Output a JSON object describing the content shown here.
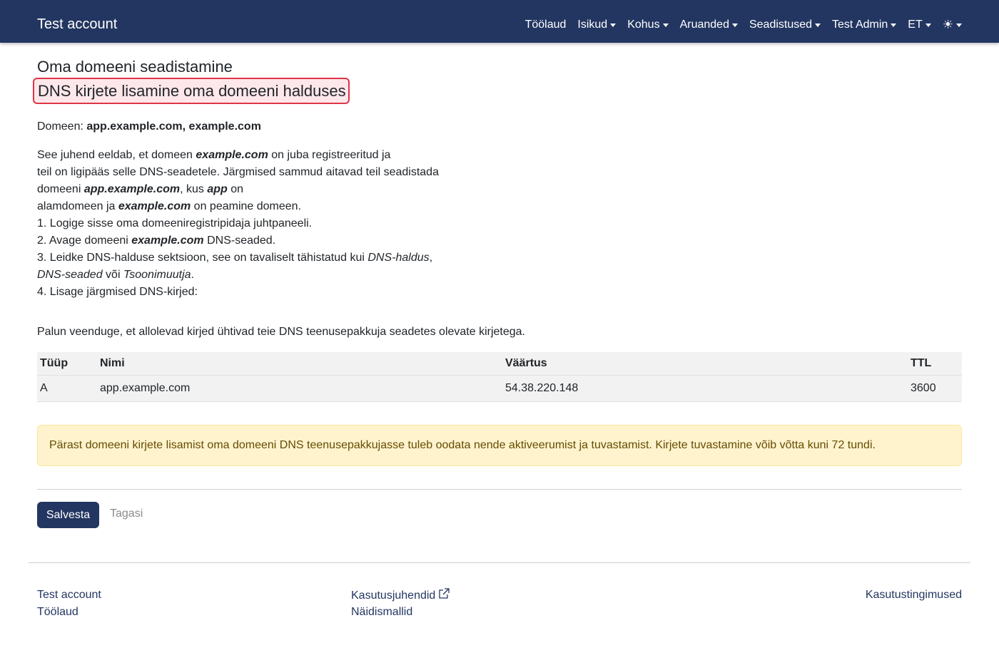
{
  "navbar": {
    "brand": "Test account",
    "items": [
      {
        "label": "Töölaud",
        "dropdown": false
      },
      {
        "label": "Isikud",
        "dropdown": true
      },
      {
        "label": "Kohus",
        "dropdown": true
      },
      {
        "label": "Aruanded",
        "dropdown": true
      },
      {
        "label": "Seadistused",
        "dropdown": true
      },
      {
        "label": "Test Admin",
        "dropdown": true
      },
      {
        "label": "ET",
        "dropdown": true
      }
    ],
    "theme_icon": "sun-icon"
  },
  "page": {
    "title": "Oma domeeni seadistamine",
    "subtitle": "DNS kirjete lisamine oma domeeni halduses",
    "domain_label": "Domeen:",
    "domain_value": "app.example.com, example.com"
  },
  "guide": {
    "p1_a": "See juhend eeldab, et domeen ",
    "p1_b": "example.com",
    "p1_c": " on juba registreeritud ja",
    "p2": "teil on ligipääs selle DNS-seadetele. Järgmised sammud aitavad teil seadistada",
    "p3_a": "domeeni ",
    "p3_b": "app.example.com",
    "p3_c": ", kus ",
    "p3_d": "app",
    "p3_e": " on",
    "p4_a": "alamdomeen ja ",
    "p4_b": "example.com",
    "p4_c": " on peamine domeen.",
    "step1": "1. Logige sisse oma domeeniregistripidaja juhtpaneeli.",
    "step2_a": "2. Avage domeeni ",
    "step2_b": "example.com",
    "step2_c": " DNS-seaded.",
    "step3_a": "3. Leidke DNS-halduse sektsioon, see on tavaliselt tähistatud kui ",
    "step3_b": "DNS-haldus",
    "step3_c": ",",
    "step3_d": "DNS-seaded",
    "step3_e": " või ",
    "step3_f": "Tsoonimuutja",
    "step3_g": ".",
    "step4": "4. Lisage järgmised DNS-kirjed:"
  },
  "confirm_text": "Palun veenduge, et allolevad kirjed ühtivad teie DNS teenusepakkuja seadetes olevate kirjetega.",
  "dns_table": {
    "headers": [
      "Tüüp",
      "Nimi",
      "Väärtus",
      "TTL"
    ],
    "rows": [
      [
        "A",
        "app.example.com",
        "54.38.220.148",
        "3600"
      ]
    ]
  },
  "alert_text": "Pärast domeeni kirjete lisamist oma domeeni DNS teenusepakkujasse tuleb oodata nende aktiveerumist ja tuvastamist. Kirjete tuvastamine võib võtta kuni 72 tundi.",
  "buttons": {
    "save": "Salvesta",
    "back": "Tagasi"
  },
  "footer": {
    "col1": [
      "Test account",
      "Töölaud"
    ],
    "col2": [
      "Kasutusjuhendid",
      "Näidismallid"
    ],
    "col3": [
      "Kasutustingimused"
    ]
  },
  "colors": {
    "navbar_bg": "#233661",
    "primary": "#233661",
    "highlight_border": "#dc3545",
    "alert_bg": "#fff3cd"
  }
}
